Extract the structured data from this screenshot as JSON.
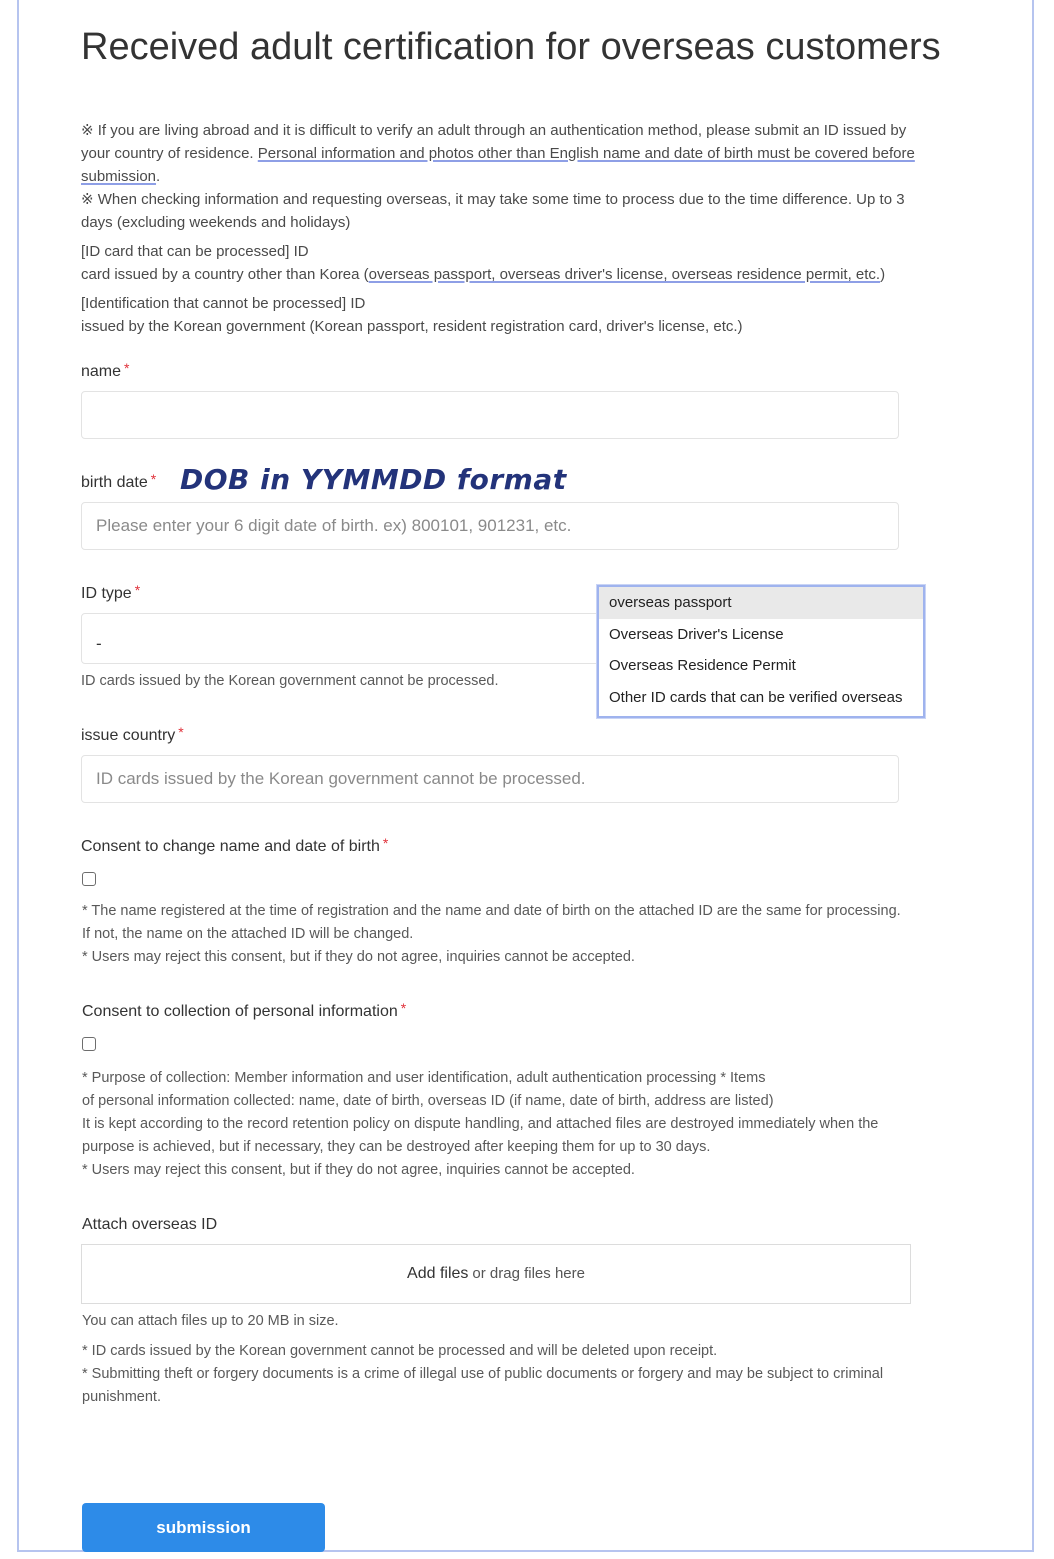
{
  "page": {
    "title": "Received adult certification for overseas customers"
  },
  "notice": {
    "line1_a": "※ If you are living abroad and it is difficult to verify an adult through an authentication method, please submit an ID issued by your country of residence. ",
    "line1_b": "Personal information and photos other than English name and date of birth must be covered before submission",
    "line1_c": ".",
    "line2": "※ When checking information and requesting overseas, it may take some time to process due to the time difference. Up to 3 days (excluding weekends and holidays)",
    "ok_heading": "[ID card that can be processed] ID",
    "ok_body_a": "card issued by a country other than Korea (",
    "ok_body_b": "overseas passport, overseas driver's license, overseas residence permit, etc.",
    "ok_body_c": ")",
    "no_heading": "[Identification that cannot be processed] ID",
    "no_body": "issued by the Korean government (Korean passport, resident registration card, driver's license, etc.)"
  },
  "form": {
    "required_mark": "*",
    "name": {
      "label": "name",
      "value": ""
    },
    "birth_date": {
      "label": "birth date",
      "placeholder": "Please enter your 6 digit date of birth.  ex) 800101, 901231, etc.",
      "annotation": "DOB in YYMMDD format"
    },
    "id_type": {
      "label": "ID type",
      "value": "-",
      "help": "ID cards issued by the Korean government cannot be processed.",
      "options": [
        "overseas passport",
        "Overseas Driver's License",
        "Overseas Residence Permit",
        "Other ID cards that can be verified overseas"
      ]
    },
    "issue_country": {
      "label": "issue country",
      "placeholder": "ID cards issued by the Korean government cannot be processed."
    },
    "consent_name": {
      "label": "Consent to change name and date of birth",
      "line1": "* The name registered at the time of registration and the name and date of birth on the attached ID are the same for processing. If not, the name on the attached ID will be changed.",
      "line2": "* Users may reject this consent, but if they do not agree, inquiries cannot be accepted."
    },
    "consent_privacy": {
      "label": "Consent to collection of personal information",
      "line1": "* Purpose of collection: Member information and user identification, adult authentication processing * Items",
      "line2": "of personal information collected: name, date of birth, overseas ID (if name, date of birth, address are listed)",
      "line3": "It is kept according to the record retention policy on dispute handling, and attached files are destroyed immediately when the purpose is achieved, but if necessary, they can be destroyed after keeping them for up to 30 days.",
      "line4": "* Users may reject this consent, but if they do not agree, inquiries cannot be accepted."
    },
    "attach": {
      "label": "Attach overseas ID",
      "add_files": "Add files",
      "drag": "or drag files here",
      "size_note": "You can attach files up to 20 MB in size.",
      "note1": "* ID cards issued by the Korean government cannot be processed and will be deleted upon receipt.",
      "note2": "* Submitting theft or forgery documents is a crime of illegal use of public documents or forgery and may be subject to criminal punishment."
    },
    "submit_label": "submission"
  }
}
